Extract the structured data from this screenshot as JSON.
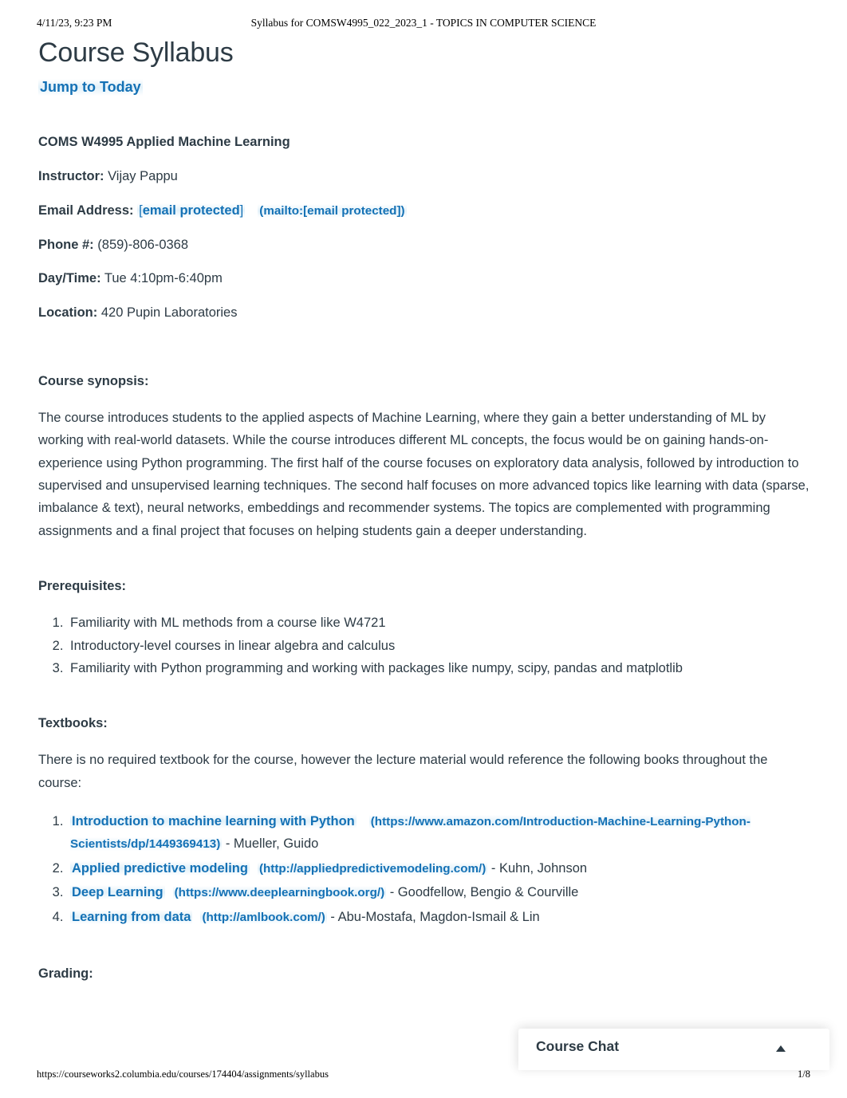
{
  "print_header": {
    "date": "4/11/23, 9:23 PM",
    "title": "Syllabus for COMSW4995_022_2023_1 - TOPICS IN COMPUTER SCIENCE"
  },
  "page": {
    "title": "Course Syllabus",
    "jump_to_today": "Jump to Today",
    "course_title": "COMS W4995 Applied Machine Learning",
    "info": {
      "instructor_label": "Instructor:",
      "instructor_value": "Vijay Pappu",
      "email_label": "Email Address:",
      "email_link_open_bracket": "[",
      "email_link_text": "email protected",
      "email_link_close_bracket": "]",
      "email_mailto_prefix": "(mailto:[",
      "email_mailto_text": "email protected",
      "email_mailto_suffix": "])",
      "phone_label": "Phone #:",
      "phone_value": "(859)-806-0368",
      "daytime_label": "Day/Time:",
      "daytime_value": "Tue 4:10pm-6:40pm",
      "location_label": "Location:",
      "location_value": "420 Pupin Laboratories"
    },
    "synopsis": {
      "heading": "Course synopsis:",
      "text": "The course introduces students to the applied aspects of Machine Learning, where they gain a better understanding of ML by working with real-world datasets. While the course introduces different ML concepts, the focus would be on gaining hands-on-experience using Python programming. The first half of the course focuses on exploratory data analysis, followed by introduction to supervised and unsupervised learning techniques. The second half focuses on more advanced topics like learning with data (sparse, imbalance & text), neural networks, embeddings and recommender systems. The topics are complemented with programming assignments and a final project that focuses on helping students gain a deeper understanding."
    },
    "prerequisites": {
      "heading": "Prerequisites:",
      "items": [
        "Familiarity with ML methods from a course like W4721",
        "Introductory-level courses in linear algebra and calculus",
        "Familiarity with Python programming and working with packages like numpy, scipy, pandas and matplotlib"
      ]
    },
    "textbooks": {
      "heading": "Textbooks:",
      "intro": "There is no required textbook for the course, however the lecture material would reference the following books throughout the course:",
      "items": [
        {
          "link_text": "Introduction to machine learning with Python",
          "url_note": "(https://www.amazon.com/Introduction-Machine-Learning-Python-Scientists/dp/1449369413)",
          "authors": " - Mueller, Guido"
        },
        {
          "link_text": "Applied predictive modeling",
          "url_note": "(http://appliedpredictivemodeling.com/)",
          "authors": " - Kuhn, Johnson"
        },
        {
          "link_text": "Deep Learning",
          "url_note": "(https://www.deeplearningbook.org/)",
          "authors": " - Goodfellow, Bengio & Courville"
        },
        {
          "link_text": "Learning from data",
          "url_note": "(http://amlbook.com/)",
          "authors": " - Abu-Mostafa, Magdon-Ismail & Lin"
        }
      ]
    },
    "grading": {
      "heading": "Grading:"
    }
  },
  "course_chat": {
    "title": "Course Chat",
    "toggle_icon": "chevron-up-icon"
  },
  "print_footer": {
    "url": "https://courseworks2.columbia.edu/courses/174404/assignments/syllabus",
    "page_number": "1/8"
  },
  "colors": {
    "link_blue": "#1471b5",
    "text": "#2d3b45",
    "highlight": "#cee7f5"
  }
}
